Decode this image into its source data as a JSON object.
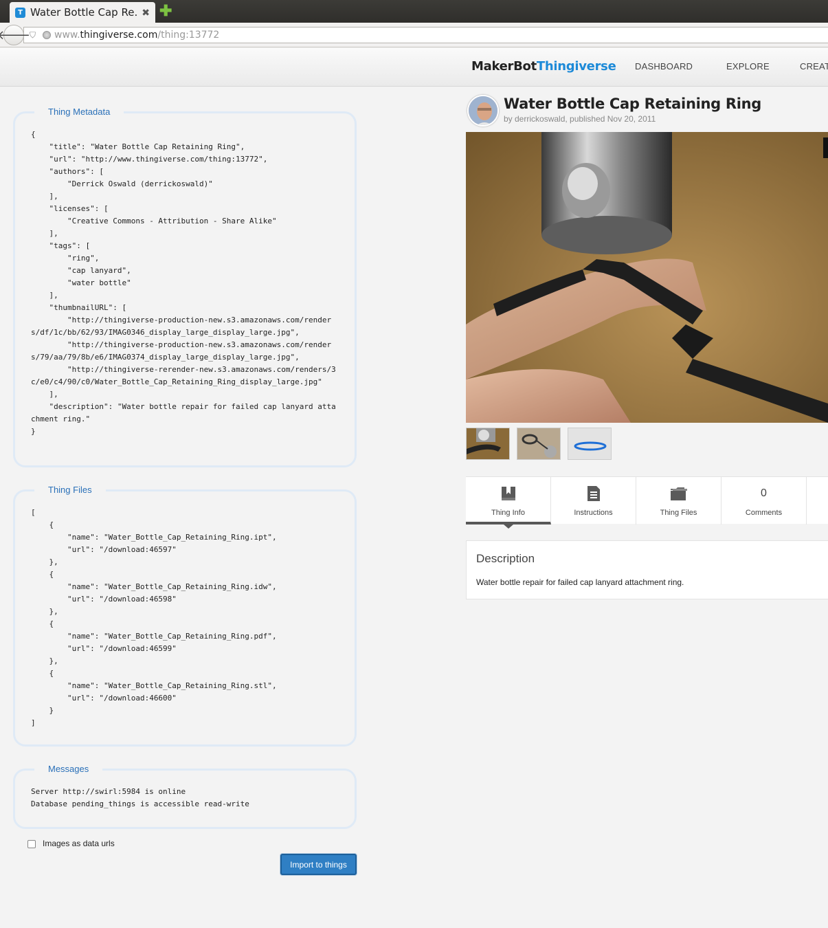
{
  "browser": {
    "tab_title": "Water Bottle Cap Re…",
    "tab_favicon_letter": "T",
    "tab_close": "✖",
    "new_tab": "✚",
    "url_prefix": "www.",
    "url_host": "thingiverse.com",
    "url_path": "/thing:13772"
  },
  "site": {
    "logo_makerbot": "MakerBot",
    "logo_thingiverse": "Thingiverse",
    "nav": [
      "DASHBOARD",
      "EXPLORE",
      "CREATE"
    ]
  },
  "panels": {
    "metadata": {
      "legend": "Thing Metadata",
      "content": "{\n    \"title\": \"Water Bottle Cap Retaining Ring\",\n    \"url\": \"http://www.thingiverse.com/thing:13772\",\n    \"authors\": [\n        \"Derrick Oswald (derrickoswald)\"\n    ],\n    \"licenses\": [\n        \"Creative Commons - Attribution - Share Alike\"\n    ],\n    \"tags\": [\n        \"ring\",\n        \"cap lanyard\",\n        \"water bottle\"\n    ],\n    \"thumbnailURL\": [\n        \"http://thingiverse-production-new.s3.amazonaws.com/renders/df/1c/bb/62/93/IMAG0346_display_large_display_large.jpg\",\n        \"http://thingiverse-production-new.s3.amazonaws.com/renders/79/aa/79/8b/e6/IMAG0374_display_large_display_large.jpg\",\n        \"http://thingiverse-rerender-new.s3.amazonaws.com/renders/3c/e0/c4/90/c0/Water_Bottle_Cap_Retaining_Ring_display_large.jpg\"\n    ],\n    \"description\": \"Water bottle repair for failed cap lanyard attachment ring.\"\n}"
    },
    "files": {
      "legend": "Thing Files",
      "content": "[\n    {\n        \"name\": \"Water_Bottle_Cap_Retaining_Ring.ipt\",\n        \"url\": \"/download:46597\"\n    },\n    {\n        \"name\": \"Water_Bottle_Cap_Retaining_Ring.idw\",\n        \"url\": \"/download:46598\"\n    },\n    {\n        \"name\": \"Water_Bottle_Cap_Retaining_Ring.pdf\",\n        \"url\": \"/download:46599\"\n    },\n    {\n        \"name\": \"Water_Bottle_Cap_Retaining_Ring.stl\",\n        \"url\": \"/download:46600\"\n    }\n]"
    },
    "messages": {
      "legend": "Messages",
      "content": "Server http://swirl:5984 is online\nDatabase pending_things is accessible read-write"
    }
  },
  "options": {
    "images_as_data_urls_label": "Images as data urls",
    "images_as_data_urls_checked": false,
    "import_button": "Import to things"
  },
  "thing": {
    "title": "Water Bottle Cap Retaining Ring",
    "byline": "by derrickoswald, published Nov 20, 2011",
    "tabs": [
      {
        "label": "Thing Info",
        "icon": "book-icon"
      },
      {
        "label": "Instructions",
        "icon": "document-icon"
      },
      {
        "label": "Thing Files",
        "icon": "folder-icon"
      },
      {
        "label": "Comments",
        "count": "0"
      }
    ],
    "description_title": "Description",
    "description_text": "Water bottle repair for failed cap lanyard attachment ring."
  }
}
